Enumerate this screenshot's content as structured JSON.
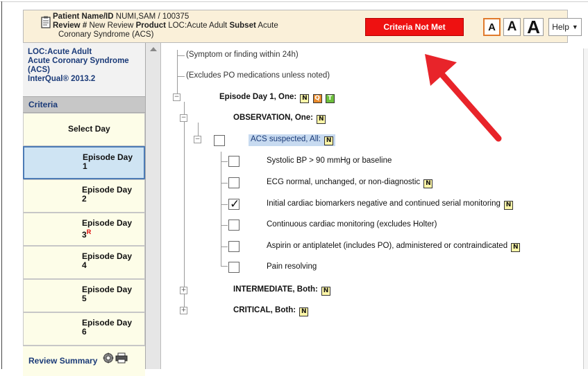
{
  "header": {
    "patient_label": "Patient Name/ID",
    "patient_value": "NUMI,SAM / 100375",
    "review_label": "Review #",
    "review_value": "New Review",
    "product_label": "Product",
    "product_value": "LOC:Acute Adult",
    "subset_label": "Subset",
    "subset_value": "Acute",
    "subset_cont": "Coronary Syndrome (ACS)",
    "criteria_status": "Criteria Not Met",
    "font_small": "A",
    "font_medium": "A",
    "font_large": "A",
    "help": "Help"
  },
  "sidebar": {
    "info": [
      "LOC:Acute Adult",
      "Acute Coronary Syndrome",
      "(ACS)",
      "InterQual® 2013.2"
    ],
    "criteria_title": "Criteria",
    "select_day": "Select Day",
    "days": [
      {
        "label": "Episode Day",
        "num": "1",
        "flag": ""
      },
      {
        "label": "Episode Day",
        "num": "2",
        "flag": ""
      },
      {
        "label": "Episode Day",
        "num": "3",
        "flag": "R"
      },
      {
        "label": "Episode Day",
        "num": "4",
        "flag": ""
      },
      {
        "label": "Episode Day",
        "num": "5",
        "flag": ""
      },
      {
        "label": "Episode Day",
        "num": "6",
        "flag": ""
      }
    ],
    "active_day_index": 0,
    "review_summary": "Review Summary"
  },
  "tree": {
    "note_symptom": "(Symptom or finding within 24h)",
    "note_po": "(Excludes PO medications unless noted)",
    "episode": "Episode Day 1, One:",
    "observation": "OBSERVATION, One:",
    "acs": "ACS suspected, All:",
    "items": [
      {
        "text": "Systolic BP > 90 mmHg or baseline",
        "checked": false,
        "note": false
      },
      {
        "text": "ECG normal, unchanged, or non-diagnostic",
        "checked": false,
        "note": true
      },
      {
        "text": "Initial cardiac biomarkers negative and continued serial monitoring",
        "checked": true,
        "note": true
      },
      {
        "text": "Continuous cardiac monitoring (excludes Holter)",
        "checked": false,
        "note": false
      },
      {
        "text": "Aspirin or antiplatelet (includes PO), administered or contraindicated",
        "checked": false,
        "note": true
      },
      {
        "text": "Pain resolving",
        "checked": false,
        "note": false
      }
    ],
    "intermediate": "INTERMEDIATE, Both:",
    "critical": "CRITICAL, Both:",
    "badge_n": "N",
    "badge_q": "Q",
    "badge_t": "T"
  },
  "colors": {
    "criteria_status_bg": "#ee1111",
    "header_bg": "#faf0d9",
    "selected_day_bg": "#cfe4f3",
    "annotation_arrow": "#e8242a"
  }
}
